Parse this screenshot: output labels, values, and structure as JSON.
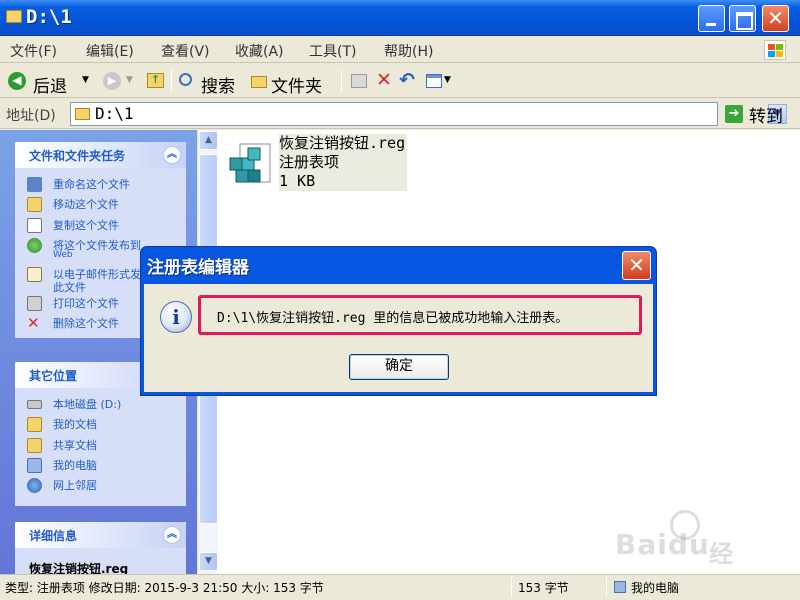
{
  "window": {
    "title": "D:\\1"
  },
  "menu": [
    "文件(F)",
    "编辑(E)",
    "查看(V)",
    "收藏(A)",
    "工具(T)",
    "帮助(H)"
  ],
  "toolbar": {
    "back_label": "后退",
    "search_label": "搜索",
    "folders_label": "文件夹"
  },
  "address": {
    "label": "地址(D)",
    "value": "D:\\1",
    "go_label": "转到"
  },
  "tasks_panel": {
    "title": "文件和文件夹任务",
    "items": [
      {
        "label": "重命名这个文件"
      },
      {
        "label": "移动这个文件"
      },
      {
        "label": "复制这个文件"
      },
      {
        "label": "将这个文件发布到",
        "label2": "Web"
      },
      {
        "label": "以电子邮件形式发送",
        "label2": "此文件"
      },
      {
        "label": "打印这个文件"
      },
      {
        "label": "删除这个文件"
      }
    ]
  },
  "places_panel": {
    "title": "其它位置",
    "items": [
      {
        "label": "本地磁盘 (D:)"
      },
      {
        "label": "我的文档"
      },
      {
        "label": "共享文档"
      },
      {
        "label": "我的电脑"
      },
      {
        "label": "网上邻居"
      }
    ]
  },
  "details_panel": {
    "title": "详细信息",
    "filename": "恢复注销按钮.reg"
  },
  "file": {
    "name": "恢复注销按钮.reg",
    "type": "注册表项",
    "size": "1 KB"
  },
  "statusbar": {
    "info": "类型: 注册表项 修改日期: 2015-9-3 21:50 大小: 153 字节",
    "size": "153 字节",
    "location": "我的电脑"
  },
  "dialog": {
    "title": "注册表编辑器",
    "message": "D:\\1\\恢复注销按钮.reg 里的信息已被成功地输入注册表。",
    "ok_label": "确定"
  },
  "watermark": {
    "brand": "Bai",
    "brand2": "du",
    "sub": "经验"
  },
  "colors": {
    "titlebar": "#0454d8",
    "highlight": "#e0195c",
    "link": "#215dc6"
  }
}
